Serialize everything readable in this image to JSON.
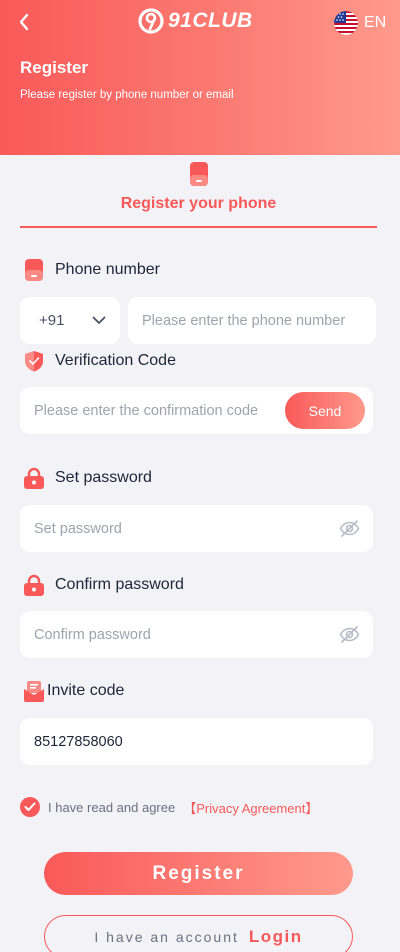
{
  "header": {
    "logo_text": "91CLUB",
    "logo_digit": "9",
    "language": "EN",
    "title": "Register",
    "subtitle": "Please register by phone number or email"
  },
  "tab": {
    "label": "Register your phone"
  },
  "phone": {
    "label": "Phone number",
    "country_code": "+91",
    "placeholder": "Please enter the phone number"
  },
  "verification": {
    "label": "Verification Code",
    "placeholder": "Please enter the confirmation code",
    "send_label": "Send"
  },
  "password": {
    "label": "Set password",
    "placeholder": "Set password"
  },
  "confirm_password": {
    "label": "Confirm password",
    "placeholder": "Confirm password"
  },
  "invite": {
    "label": "Invite code",
    "value": "85127858060"
  },
  "agreement": {
    "text": "I have read and agree",
    "link": "【Privacy Agreement】"
  },
  "actions": {
    "register_label": "Register",
    "have_account": "I have an account",
    "login_label": "Login"
  },
  "colors": {
    "accent": "#f95959",
    "accent_light": "#ff9a8c",
    "background": "#f2f2f7"
  }
}
